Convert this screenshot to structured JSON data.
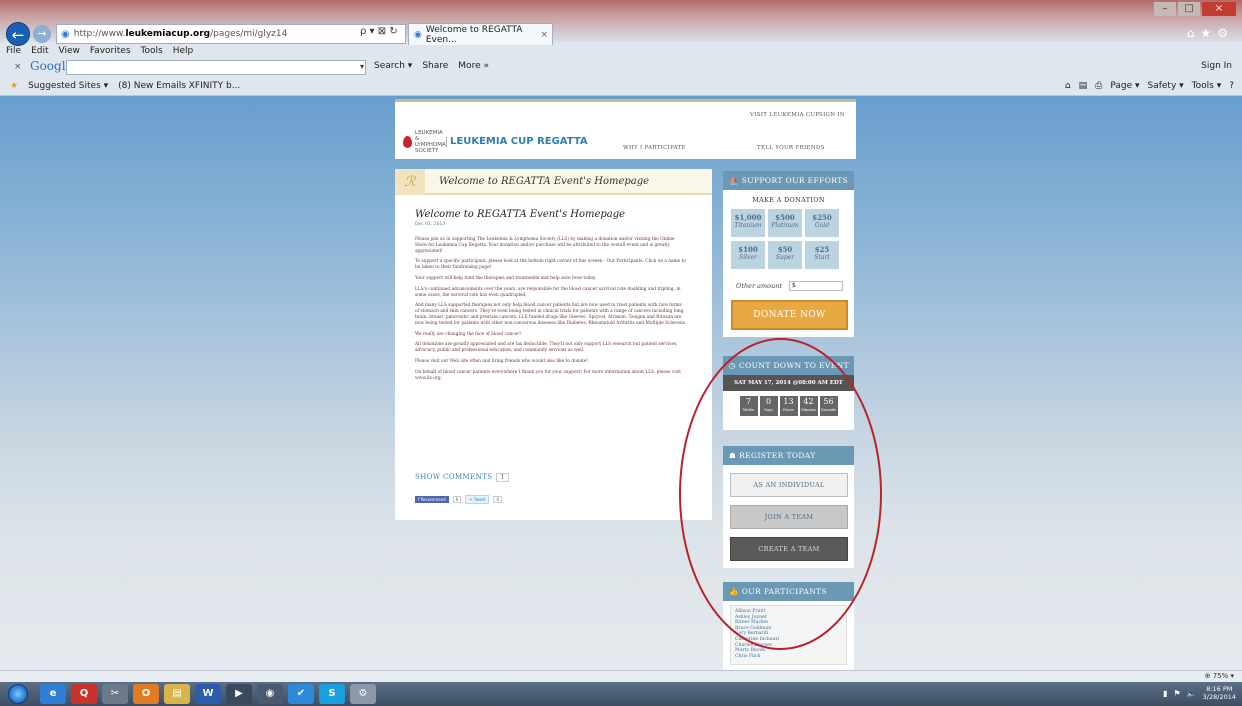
{
  "browser": {
    "url_prefix": "http://www.",
    "url_host": "leukemiacup.org",
    "url_path": "/pages/mi/glyz14",
    "address_tools": "ρ ▾ ⊠ ↻",
    "tab_title": "Welcome to REGATTA Even...",
    "menu": [
      "File",
      "Edit",
      "View",
      "Favorites",
      "Tools",
      "Help"
    ],
    "google_logo": "Google",
    "google_tools": [
      "Search ▾",
      "Share",
      "More »"
    ],
    "sign_in": "Sign In",
    "favorites": [
      "Suggested Sites ▾",
      "(8) New Emails XFINITY b..."
    ],
    "ie_commands": [
      "Page ▾",
      "Safety ▾",
      "Tools ▾"
    ],
    "zoom": "75%"
  },
  "header": {
    "logo_org": "LEUKEMIA & LYMPHOMA SOCIETY",
    "logo_event": "LEUKEMIA CUP REGATTA",
    "links": {
      "visit": "VISIT LEUKEMIA CUP",
      "sign_in": "SIGN IN",
      "why_participate": "WHY I PARTICIPATE",
      "tell_friends": "TELL YOUR FRIENDS"
    }
  },
  "article": {
    "banner_title": "Welcome to REGATTA Event's Homepage",
    "title": "Welcome to REGATTA Event's Homepage",
    "date": "Dec 01, 2013",
    "paragraphs": [
      "Please join us in supporting The Leukemia & Lymphoma Society (LLS) by making a donation and/or visiting the Online Store for Leukemia Cup Regatta. Your donation and/or purchase will be attributed to the overall event and is greatly appreciated!",
      "To support a specific participant, please look at the bottom right corner of this screen - Our Participants. Click on a name to be taken to their fundraising page!",
      "Your support will help fund the therapies and treatments and help save lives today.",
      "LLS's continued advancements over the years, are responsible for the blood cancer survival rate doubling and tripling; in some cases, the survival rate has even quadrupled.",
      "And many LLS supported therapies not only help blood cancer patients but are now used to treat patients with rare forms of stomach and skin cancers. They're even being tested in clinical trials for patients with a range of cancers including lung, brain, breast, pancreatic and prostate cancers. LLS funded drugs like Gleevec, Sprycel, Arranon, Tasigna and Rituxan are now being tested for patients with other non-cancerous diseases like Diabetes, Rheumatoid Arthritis and Multiple Sclerosis.",
      "We really are changing the face of blood cancer!",
      "All donations are greatly appreciated and are tax deductible. They'll not only support LLS research but patient services, advocacy, public and professional education, and community services as well.",
      "Please visit our Web site often and bring friends who would also like to donate!",
      "On behalf of blood cancer patients everywhere I thank you for your support! For more information about LLS, please visit www.lls.org."
    ],
    "show_comments": "SHOW COMMENTS",
    "comment_count": "1",
    "recommend": "Recommend",
    "recommend_count": "0",
    "tweet": "Tweet",
    "tweet_count": "0"
  },
  "donate": {
    "header": "SUPPORT OUR EFFORTS",
    "make_donation": "MAKE A DONATION",
    "tiers": [
      {
        "amount": "$1,000",
        "name": "Titanium"
      },
      {
        "amount": "$500",
        "name": "Platinum"
      },
      {
        "amount": "$250",
        "name": "Gold"
      },
      {
        "amount": "$100",
        "name": "Silver"
      },
      {
        "amount": "$50",
        "name": "Super"
      },
      {
        "amount": "$25",
        "name": "Start"
      }
    ],
    "other_amount_label": "Other amount",
    "other_amount_value": "$",
    "donate_now": "DONATE NOW"
  },
  "countdown": {
    "header": "COUNT DOWN TO EVENT",
    "event_date": "SAT MAY 17, 2014 @08:00 AM  EDT",
    "units": [
      {
        "value": "7",
        "label": "Weeks"
      },
      {
        "value": "0",
        "label": "Days"
      },
      {
        "value": "13",
        "label": "Hours"
      },
      {
        "value": "42",
        "label": "Minutes"
      },
      {
        "value": "56",
        "label": "Seconds"
      }
    ]
  },
  "register": {
    "header": "REGISTER TODAY",
    "individual": "AS AN INDIVIDUAL",
    "join_team": "JOIN A TEAM",
    "create_team": "CREATE A TEAM"
  },
  "participants": {
    "header": "OUR PARTICIPANTS",
    "names": [
      "Allison Pruitt",
      "Ashley Joyner",
      "Bitner Mackie",
      "Bruce Goldman",
      "Cory Bernardi",
      "Catherine Inchauri",
      "Charles Starner",
      "Marty Bloom",
      "Chris Flick"
    ]
  },
  "taskbar": {
    "apps": [
      "e",
      "Q",
      "✂",
      "O",
      "▤",
      "W",
      "▶",
      "◉",
      "✔",
      "S",
      "⚙"
    ],
    "time": "8:16 PM",
    "date": "3/28/2014"
  },
  "colors": {
    "widget_header": "#6b98b5",
    "donate_button": "#e8a842",
    "annotation_circle": "#b8232b",
    "lls_red": "#c1272d"
  }
}
